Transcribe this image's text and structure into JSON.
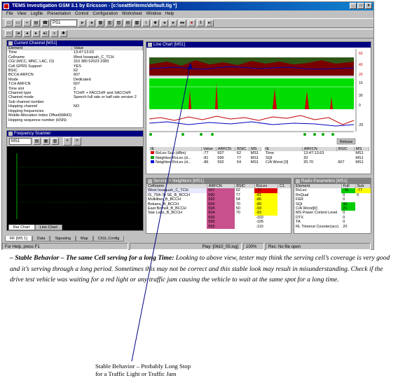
{
  "window": {
    "title": "TEMS Investigation GSM 3.1 by Ericsson - [c:\\seattle\\tems\\default.tig *]",
    "controls": [
      "_",
      "□",
      "x"
    ],
    "menu": [
      "File",
      "View",
      "Logfile",
      "Presentation",
      "Control",
      "Configuration",
      "Worksheet",
      "Window",
      "Help"
    ]
  },
  "toolbar": {
    "port_combo": "PS1"
  },
  "current_channel": {
    "title": "Current Channel [MS1]",
    "headers": [
      "Element",
      "Value"
    ],
    "rows": [
      [
        "Time",
        "13:47:13.63"
      ],
      [
        "Cellname",
        "West Issaquah_C_TCH"
      ],
      [
        "CGI (MCC, MNC, LAC, CI)",
        "310 380 52023 2383"
      ],
      [
        "Cell GPRS Support",
        "YES"
      ],
      [
        "BSIC",
        "62"
      ],
      [
        "BCCH ARFCN",
        "607"
      ],
      [
        "Mode",
        "Dedicated"
      ],
      [
        "TCH ARFCN",
        "607"
      ],
      [
        "Time slot",
        "3"
      ],
      [
        "Channel type",
        "TCH/F + FACCH/F and SACCH/F"
      ],
      [
        "Channel mode",
        "Speech full rate or half rate version 2"
      ],
      [
        "Sub channel number",
        ""
      ],
      [
        "Hopping channel",
        "NO"
      ],
      [
        "Hopping frequencies",
        ""
      ],
      [
        "Mobile Allocation Index Offset(MAIO)",
        ""
      ],
      [
        "Hopping sequence number (HSN)",
        ""
      ]
    ]
  },
  "frequency_scanner": {
    "title": "Frequency Scanner",
    "ms": "MS1",
    "tabs": [
      "Bar Chart",
      "Line Chart"
    ]
  },
  "line_chart": {
    "title": "Line Chart [MS1]",
    "release_label": "Release",
    "axis_right": [
      "60",
      "40",
      "20",
      "10",
      "30",
      "0",
      "-20"
    ],
    "legend_table": {
      "headers": [
        "IE",
        "Value",
        "ARFCN",
        "BSIC",
        "MS"
      ],
      "rows": [
        [
          "RxLev Sub (dBm)",
          "-77",
          "607",
          "62",
          "MS1"
        ],
        [
          "Neighbor RxLev (d...",
          "-81",
          "590",
          "77",
          "MS1"
        ],
        [
          "Neighbor RxLev (d...",
          "-86",
          "592",
          "54",
          "MS1"
        ]
      ],
      "colors": [
        "#e00000",
        "#00a000",
        "#0000e0"
      ]
    },
    "right_table": {
      "headers": [
        "IE",
        "ARFCN",
        "BSIC",
        "MS"
      ],
      "rows": [
        [
          "Time",
          "13:47:13.63",
          "",
          "MS1"
        ],
        [
          "SQI",
          "20",
          "",
          "MS1"
        ],
        [
          "C/A Worst [0]",
          "20.70",
          "607",
          "MS1"
        ]
      ]
    }
  },
  "serving_neighbors": {
    "title": "Serving + Neighbors [MS1]",
    "headers": [
      "Cellname",
      "ARFCN",
      "BSIC",
      "RxLev",
      "C1"
    ],
    "rows": [
      [
        "West Issaquah_C_TCH",
        "607",
        "62",
        "-77",
        ""
      ],
      [
        "IS_75th St SE_B_BCCH",
        "590",
        "77",
        "-81",
        ""
      ],
      [
        "Mulkiltao_B_BCCH",
        "592",
        "54",
        "-86",
        ""
      ],
      [
        "Bokanu_B_BCCH",
        "605",
        "70",
        "-89",
        ""
      ],
      [
        "East Bothell_B_BCCH",
        "594",
        "50",
        "-93",
        ""
      ],
      [
        "Star Lake_B_BCCH",
        "604",
        "70",
        "-93",
        ""
      ],
      [
        "",
        "600",
        "",
        "-102",
        ""
      ],
      [
        "",
        "599",
        "",
        "-105",
        ""
      ],
      [
        "",
        "593",
        "",
        "-110",
        ""
      ]
    ]
  },
  "radio_parameters": {
    "title": "Radio Parameters [MS1]",
    "headers": [
      "Element",
      "Full",
      "Sub"
    ],
    "rows": [
      [
        "RxLev",
        "-76",
        "-77"
      ],
      [
        "RxQual",
        "0",
        "0"
      ],
      [
        "FER",
        "0",
        ""
      ],
      [
        "SQI",
        "30",
        ""
      ],
      [
        "C/A Worst[0]",
        "21",
        ""
      ],
      [
        "MS Power Control Level",
        "0",
        ""
      ],
      [
        "DTX",
        "0",
        ""
      ],
      [
        "TA",
        "0",
        ""
      ],
      [
        "RL Timeout Counter(acc)",
        "20",
        ""
      ]
    ]
  },
  "bottom_tabs": [
    "RF [MS 1]",
    "Data",
    "Signaling",
    "Map",
    "Ch1L.Config"
  ],
  "statusbar": {
    "help": "For Help, press F1",
    "play": "Play: [0610_05.log]",
    "percent": "100%",
    "rec": "Rec: No file open"
  },
  "caption": {
    "lead": "– Stable Behavior – The same Cell serving for a long Time:",
    "body": " Looking to above view, tester may think the serving cell’s coverage is very good and it’s serving through a long period. Sometimes this may not be correct and this stable look may result in misunderstanding. Check if the drive test vehicle was waiting for a red light or any traffic jam causing the vehicle to wait at the same spot for a long time."
  },
  "annotation": {
    "line1": "Stable Behavior – Probably Long Stop",
    "line2": "for a Traffic Light or Traffic Jam"
  }
}
